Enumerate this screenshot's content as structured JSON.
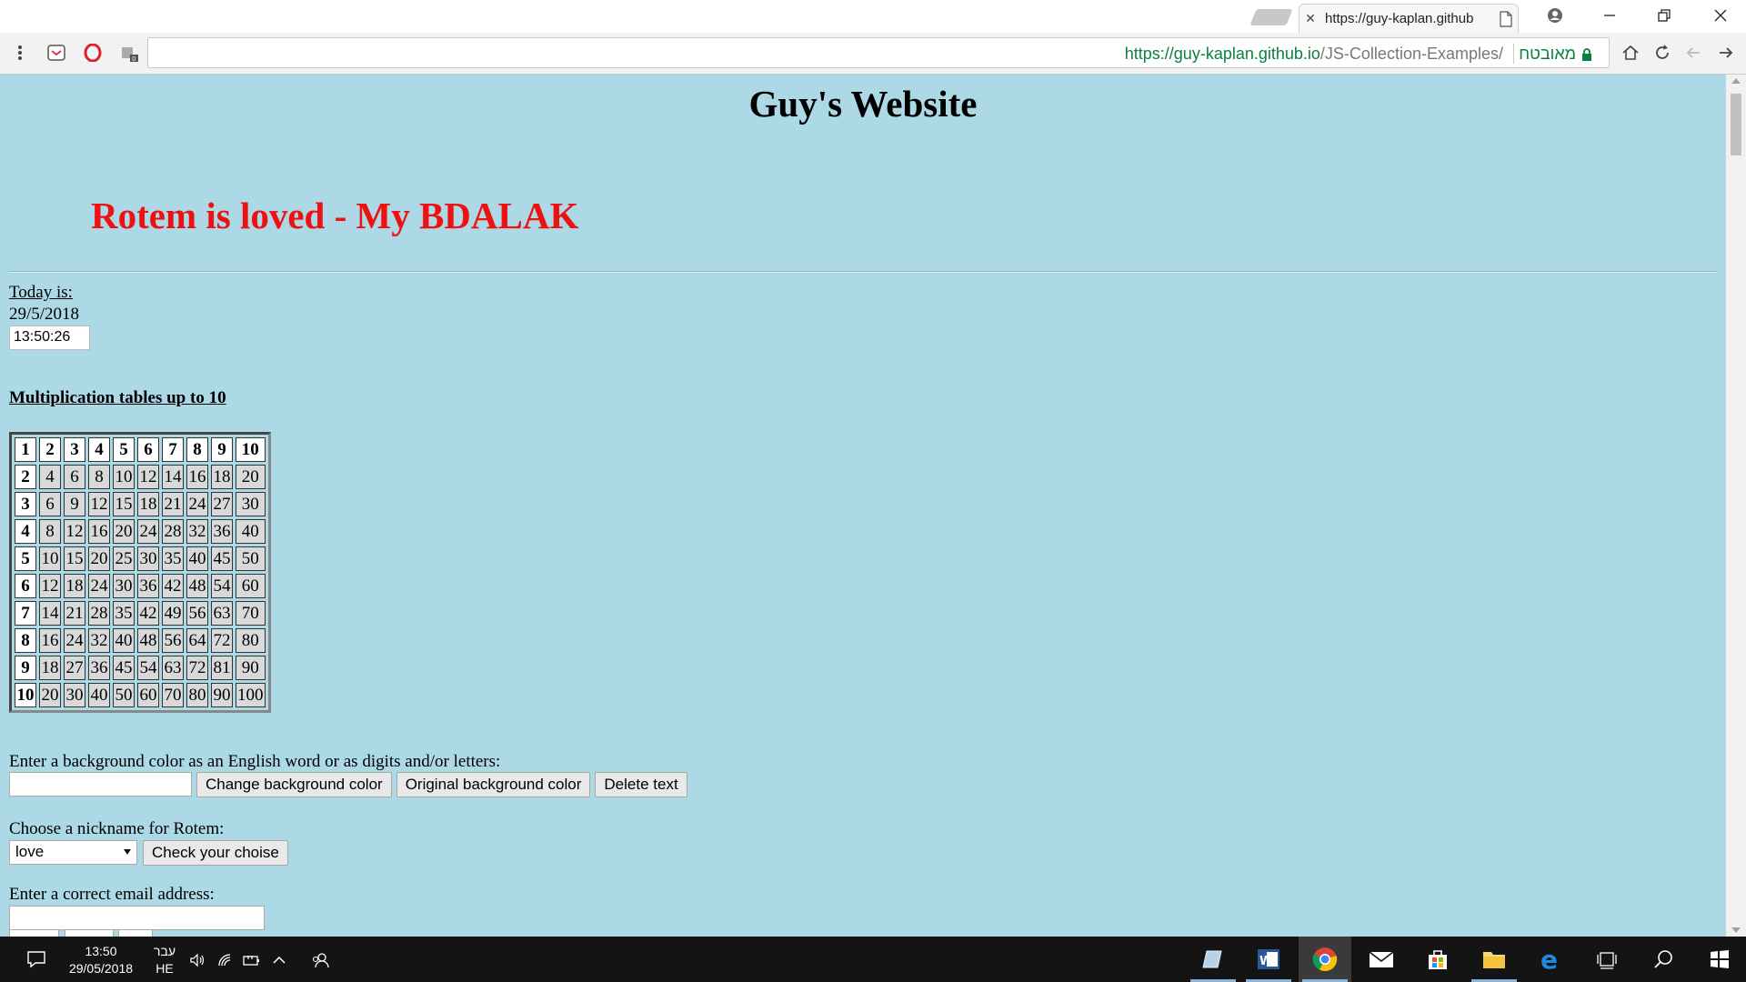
{
  "browser": {
    "tab_title": "https://guy-kaplan.github",
    "tab_close": "✕",
    "url_scheme": "https://",
    "url_host": "guy-kaplan.github.io",
    "url_path": "/JS-Collection-Examples/",
    "secure_label": "מאובטח"
  },
  "page": {
    "site_title": "Guy's Website",
    "loved_heading": "Rotem is loved - My BDALAK",
    "loved_color": "#ee1111",
    "background_color": "#add8e6",
    "today_label": "Today is:",
    "date": "29/5/2018",
    "clock": "13:50:26",
    "mult_title": "Multiplication tables up to 10",
    "table": {
      "size": 10
    },
    "bg_label": "Enter a background color as an English word or as digits and/or letters:",
    "bg_input_value": "",
    "change_bg_button": "Change background color",
    "original_bg_button": "Original background color",
    "delete_text_button": "Delete text",
    "nickname_label": "Choose a nickname for Rotem:",
    "nickname_selected": "love",
    "check_choice_button": "Check your choise",
    "email_label": "Enter a correct email address:",
    "email_value": ""
  },
  "taskbar": {
    "time": "13:50",
    "date": "29/05/2018",
    "lang_top": "עבר",
    "lang_bottom": "HE"
  }
}
